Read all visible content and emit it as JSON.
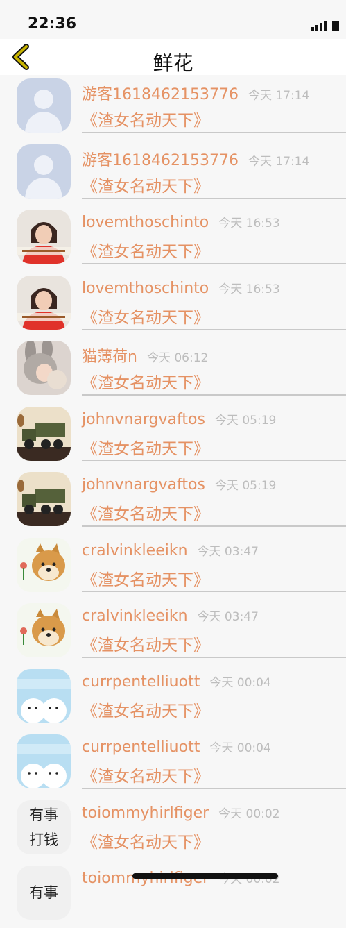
{
  "status": {
    "time": "22:36"
  },
  "header": {
    "title": "鲜花"
  },
  "rows": [
    {
      "name": "游客1618462153776",
      "time": "今天 17:14",
      "book": "《渣女名动天下》",
      "avatar": "default-avatar"
    },
    {
      "name": "游客1618462153776",
      "time": "今天 17:14",
      "book": "《渣女名动天下》",
      "avatar": "default-avatar"
    },
    {
      "name": "lovemthoschinto",
      "time": "今天 16:53",
      "book": "《渣女名动天下》",
      "avatar": "girl-red-shirt-photo"
    },
    {
      "name": "lovemthoschinto",
      "time": "今天 16:53",
      "book": "《渣女名动天下》",
      "avatar": "girl-red-shirt-photo"
    },
    {
      "name": "猫薄荷n",
      "time": "今天 06:12",
      "book": "《渣女名动天下》",
      "avatar": "bunny-hat-photo"
    },
    {
      "name": "johnvnargvaftos",
      "time": "今天 05:19",
      "book": "《渣女名动天下》",
      "avatar": "military-truck-photo"
    },
    {
      "name": "johnvnargvaftos",
      "time": "今天 05:19",
      "book": "《渣女名动天下》",
      "avatar": "military-truck-photo"
    },
    {
      "name": "cralvinkleeikn",
      "time": "今天 03:47",
      "book": "《渣女名动天下》",
      "avatar": "shiba-dog-photo"
    },
    {
      "name": "cralvinkleeikn",
      "time": "今天 03:47",
      "book": "《渣女名动天下》",
      "avatar": "shiba-dog-photo"
    },
    {
      "name": "currpentelliuott",
      "time": "今天 00:04",
      "book": "《渣女名动天下》",
      "avatar": "cartoon-bears-photo"
    },
    {
      "name": "currpentelliuott",
      "time": "今天 00:04",
      "book": "《渣女名动天下》",
      "avatar": "cartoon-bears-photo"
    },
    {
      "name": "toiommyhirlfiger",
      "time": "今天 00:02",
      "book": "《渣女名动天下》",
      "avatar": "text-avatar",
      "avatar_text": [
        "有事",
        "打钱"
      ]
    },
    {
      "name": "toiommyhirlfiger",
      "time": "今天 00:02",
      "book": "",
      "avatar": "text-avatar",
      "avatar_text": [
        "有事",
        ""
      ]
    }
  ],
  "colors": {
    "accent": "#e59264",
    "time": "#bdbdbd",
    "back": "#c8b400"
  }
}
